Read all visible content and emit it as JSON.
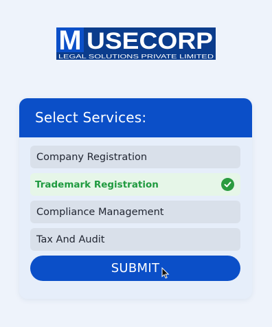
{
  "brand": {
    "logo_letter": "M",
    "logo_name": "USECORP",
    "tagline": "LEGAL SOLUTIONS PRIVATE LIMITED",
    "color_blue": "#0b4fc8",
    "color_navy": "#0b3c8c"
  },
  "form": {
    "title": "Select Services:",
    "options": [
      {
        "label": "Company Registration",
        "selected": false
      },
      {
        "label": "Trademark Registration",
        "selected": true
      },
      {
        "label": "Compliance Management",
        "selected": false
      },
      {
        "label": "Tax And Audit",
        "selected": false
      }
    ],
    "submit_label": "SUBMIT"
  },
  "colors": {
    "accent": "#0b4fc8",
    "selected_text": "#1f9a3f",
    "selected_bg": "#e6f6e8",
    "option_bg": "#d9e0ea",
    "page_bg": "#eef3fb"
  },
  "icons": {
    "selected": "check-circle-icon",
    "pointer": "mouse-cursor-icon"
  }
}
